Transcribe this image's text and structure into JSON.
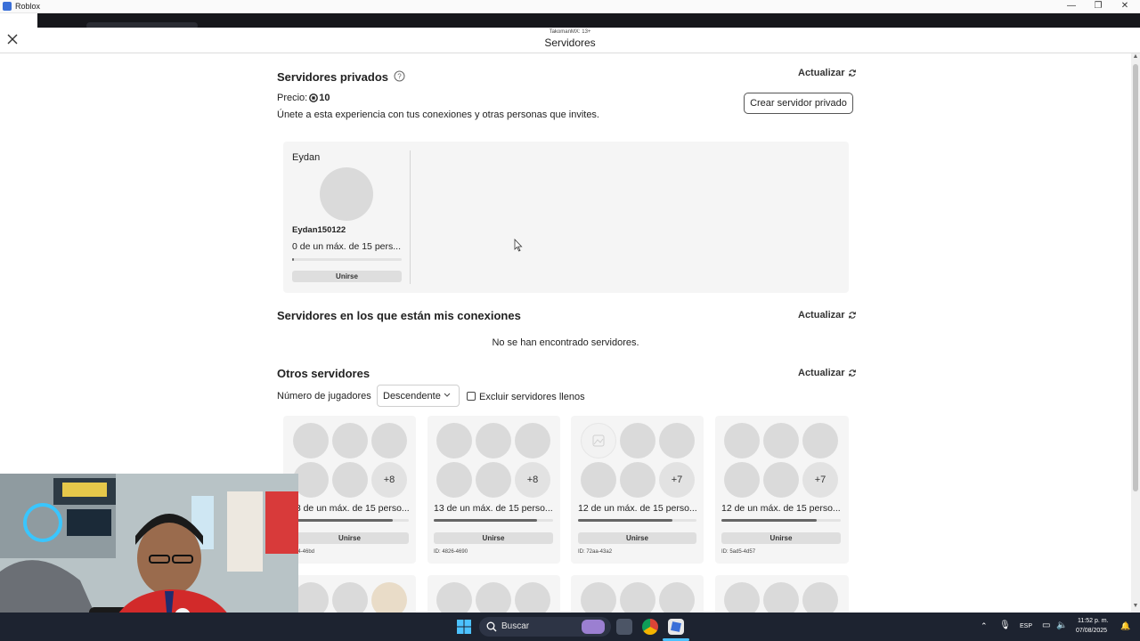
{
  "window": {
    "title": "Roblox",
    "minimize": "—",
    "maximize": "❐",
    "close": "✕"
  },
  "modal": {
    "subtitle": "TakomanMX: 13+",
    "title": "Servidores"
  },
  "private_servers": {
    "title": "Servidores privados",
    "refresh_label": "Actualizar",
    "price_label": "Precio:",
    "price_value": "10",
    "description": "Únete a esta experiencia con tus conexiones y otras personas que invites.",
    "create_button": "Crear servidor privado",
    "server": {
      "name": "Eydan",
      "owner": "Eydan150122",
      "players_text": "0 de un máx. de 15 pers...",
      "players": 0,
      "max_players": 15,
      "join_label": "Unirse"
    }
  },
  "connections_servers": {
    "title": "Servidores en los que están mis conexiones",
    "refresh_label": "Actualizar",
    "empty_text": "No se han encontrado servidores."
  },
  "other_servers": {
    "title": "Otros servidores",
    "refresh_label": "Actualizar",
    "filter_label": "Número de jugadores",
    "sort_value": "Descendente",
    "exclude_full_label": "Excluir servidores llenos",
    "exclude_full_checked": false,
    "servers": [
      {
        "players_text": "13 de un máx. de 15 perso...",
        "players": 13,
        "max_players": 15,
        "extra": "+8",
        "join_label": "Unirse",
        "id": "9ef4-46bd"
      },
      {
        "players_text": "13 de un máx. de 15 perso...",
        "players": 13,
        "max_players": 15,
        "extra": "+8",
        "join_label": "Unirse",
        "id": "ID: 4826-4690"
      },
      {
        "players_text": "12 de un máx. de 15 perso...",
        "players": 12,
        "max_players": 15,
        "extra": "+7",
        "join_label": "Unirse",
        "id": "ID: 72aa-43a2"
      },
      {
        "players_text": "12 de un máx. de 15 perso...",
        "players": 12,
        "max_players": 15,
        "extra": "+7",
        "join_label": "Unirse",
        "id": "ID: 5ad5-4d57"
      }
    ]
  },
  "taskbar": {
    "search_placeholder": "Buscar",
    "language": "ESP",
    "time": "11:52 p. m.",
    "date": "07/08/2025"
  },
  "colors": {
    "accent": "#3a6fd8",
    "taskbar": "#1d2330",
    "card": "#f5f5f5"
  }
}
